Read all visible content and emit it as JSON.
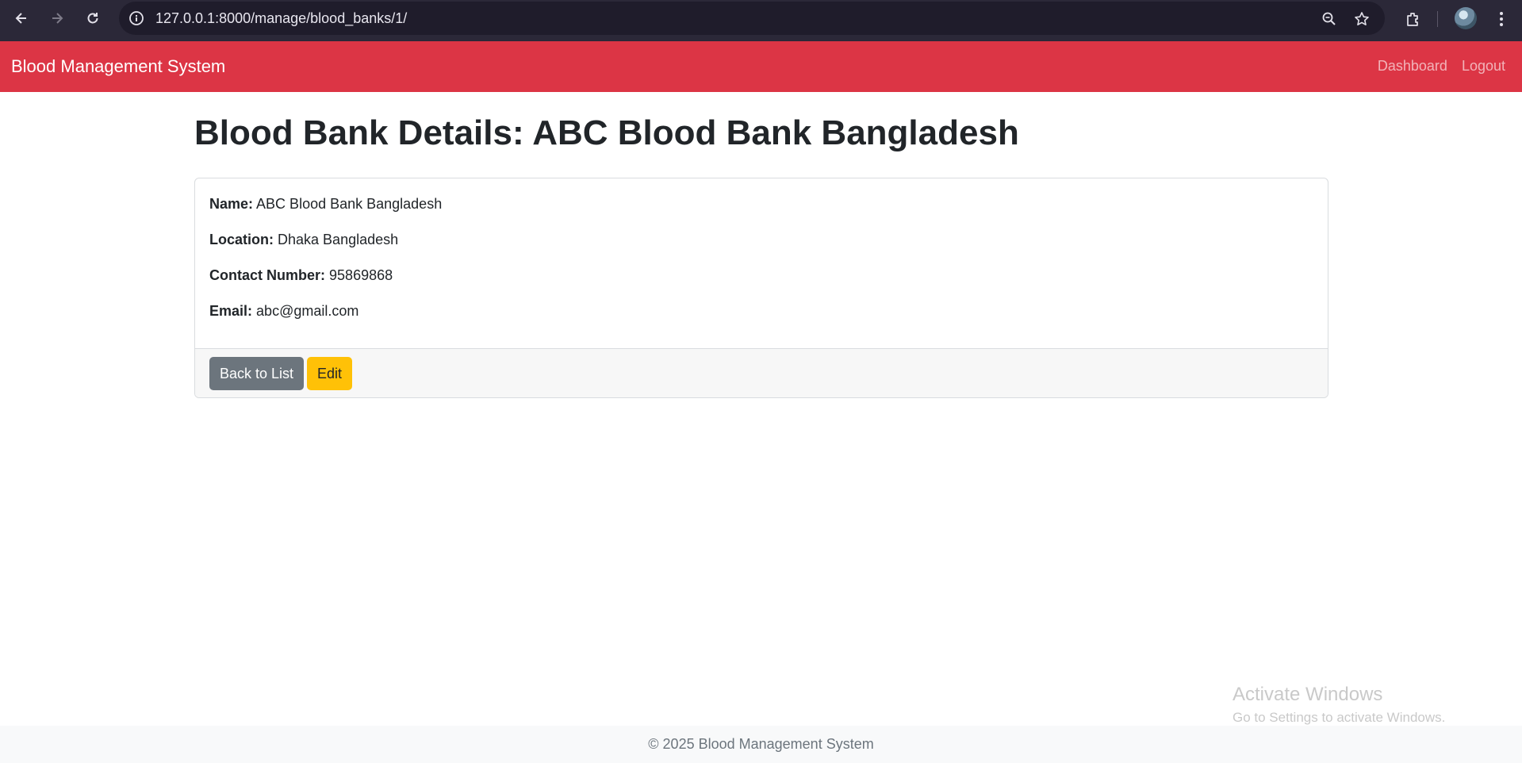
{
  "browser": {
    "url": "127.0.0.1:8000/manage/blood_banks/1/",
    "icons": [
      "back-arrow-icon",
      "forward-arrow-icon",
      "reload-icon",
      "site-info-icon",
      "zoom-icon",
      "bookmark-star-icon",
      "extensions-icon",
      "profile-avatar",
      "more-menu-icon"
    ]
  },
  "navbar": {
    "brand": "Blood Management System",
    "links": [
      "Dashboard",
      "Logout"
    ],
    "color": "#dc3545"
  },
  "main": {
    "title": "Blood Bank Details: ABC Blood Bank Bangladesh",
    "fields": [
      {
        "label": "Name:",
        "value": "ABC Blood Bank Bangladesh"
      },
      {
        "label": "Location:",
        "value": "Dhaka Bangladesh"
      },
      {
        "label": "Contact Number:",
        "value": "95869868"
      },
      {
        "label": "Email:",
        "value": "abc@gmail.com"
      }
    ],
    "buttons": {
      "back": "Back to List",
      "edit": "Edit"
    }
  },
  "watermark": {
    "title": "Activate Windows",
    "subtitle": "Go to Settings to activate Windows."
  },
  "footer": {
    "text": "© 2025 Blood Management System"
  }
}
